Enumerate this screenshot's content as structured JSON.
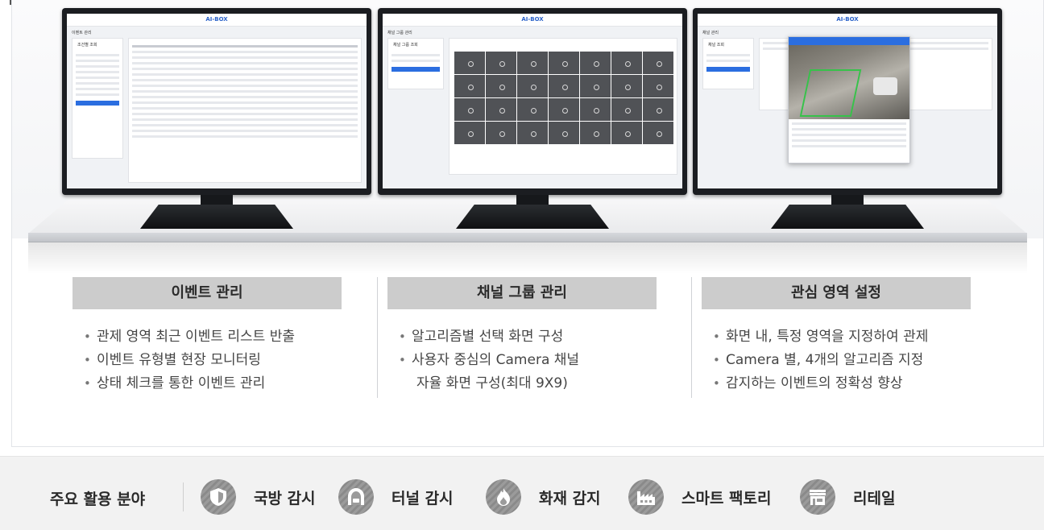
{
  "showcase": {
    "monitors": [
      {
        "screen_logo": "AI-BOX",
        "screen_title": "이벤트 관리",
        "panel_title": "조건별 조회"
      },
      {
        "screen_logo": "AI-BOX",
        "screen_title": "채널 그룹 관리",
        "panel_title": "채널 그룹 조회"
      },
      {
        "screen_logo": "AI-BOX",
        "screen_title": "채널 관리",
        "panel_title": "채널 조회"
      }
    ]
  },
  "sections": [
    {
      "title": "이벤트 관리",
      "bullets": [
        "관제 영역 최근 이벤트 리스트 반출",
        "이벤트 유형별 현장 모니터링",
        "상태 체크를 통한 이벤트 관리"
      ]
    },
    {
      "title": "채널 그룹 관리",
      "bullets": [
        "알고리즘별 선택 화면 구성",
        "사용자 중심의 Camera 채널",
        "자율 화면 구성(최대 9X9)"
      ]
    },
    {
      "title": "관심 영역 설정",
      "bullets": [
        "화면 내, 특정 영역을 지정하여 관제",
        "Camera 별, 4개의 알고리즘 지정",
        "감지하는 이벤트의 정확성 향상"
      ]
    }
  ],
  "fields": {
    "label": "주요 활용 분야",
    "items": [
      {
        "label": "국방 감시",
        "icon": "shield-icon"
      },
      {
        "label": "터널 감시",
        "icon": "tunnel-icon"
      },
      {
        "label": "화재 감지",
        "icon": "fire-icon"
      },
      {
        "label": "스마트 팩토리",
        "icon": "factory-icon"
      },
      {
        "label": "리테일",
        "icon": "store-icon"
      }
    ]
  }
}
